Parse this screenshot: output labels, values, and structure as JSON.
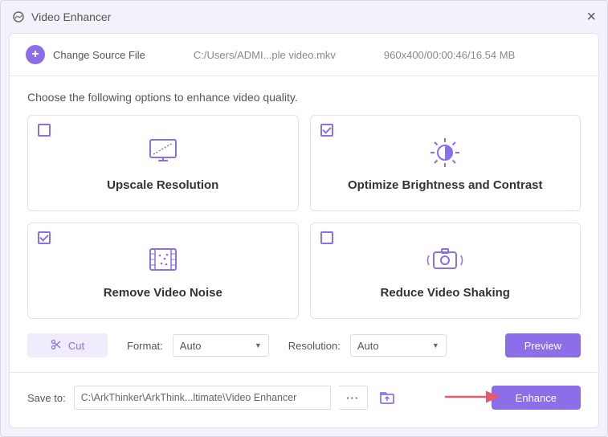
{
  "window": {
    "title": "Video Enhancer"
  },
  "header": {
    "change_source": "Change Source File",
    "filepath": "C:/Users/ADMI...ple video.mkv",
    "fileinfo": "960x400/00:00:46/16.54 MB"
  },
  "instruction": "Choose the following options to enhance video quality.",
  "options": {
    "upscale": {
      "label": "Upscale Resolution",
      "checked": false
    },
    "brightness": {
      "label": "Optimize Brightness and Contrast",
      "checked": true
    },
    "noise": {
      "label": "Remove Video Noise",
      "checked": true
    },
    "shaking": {
      "label": "Reduce Video Shaking",
      "checked": false
    }
  },
  "controls": {
    "cut": "Cut",
    "format_label": "Format:",
    "format_value": "Auto",
    "resolution_label": "Resolution:",
    "resolution_value": "Auto",
    "preview": "Preview"
  },
  "footer": {
    "save_label": "Save to:",
    "save_path": "C:\\ArkThinker\\ArkThink...ltimate\\Video Enhancer",
    "enhance": "Enhance"
  },
  "colors": {
    "accent": "#8b6ee8"
  }
}
